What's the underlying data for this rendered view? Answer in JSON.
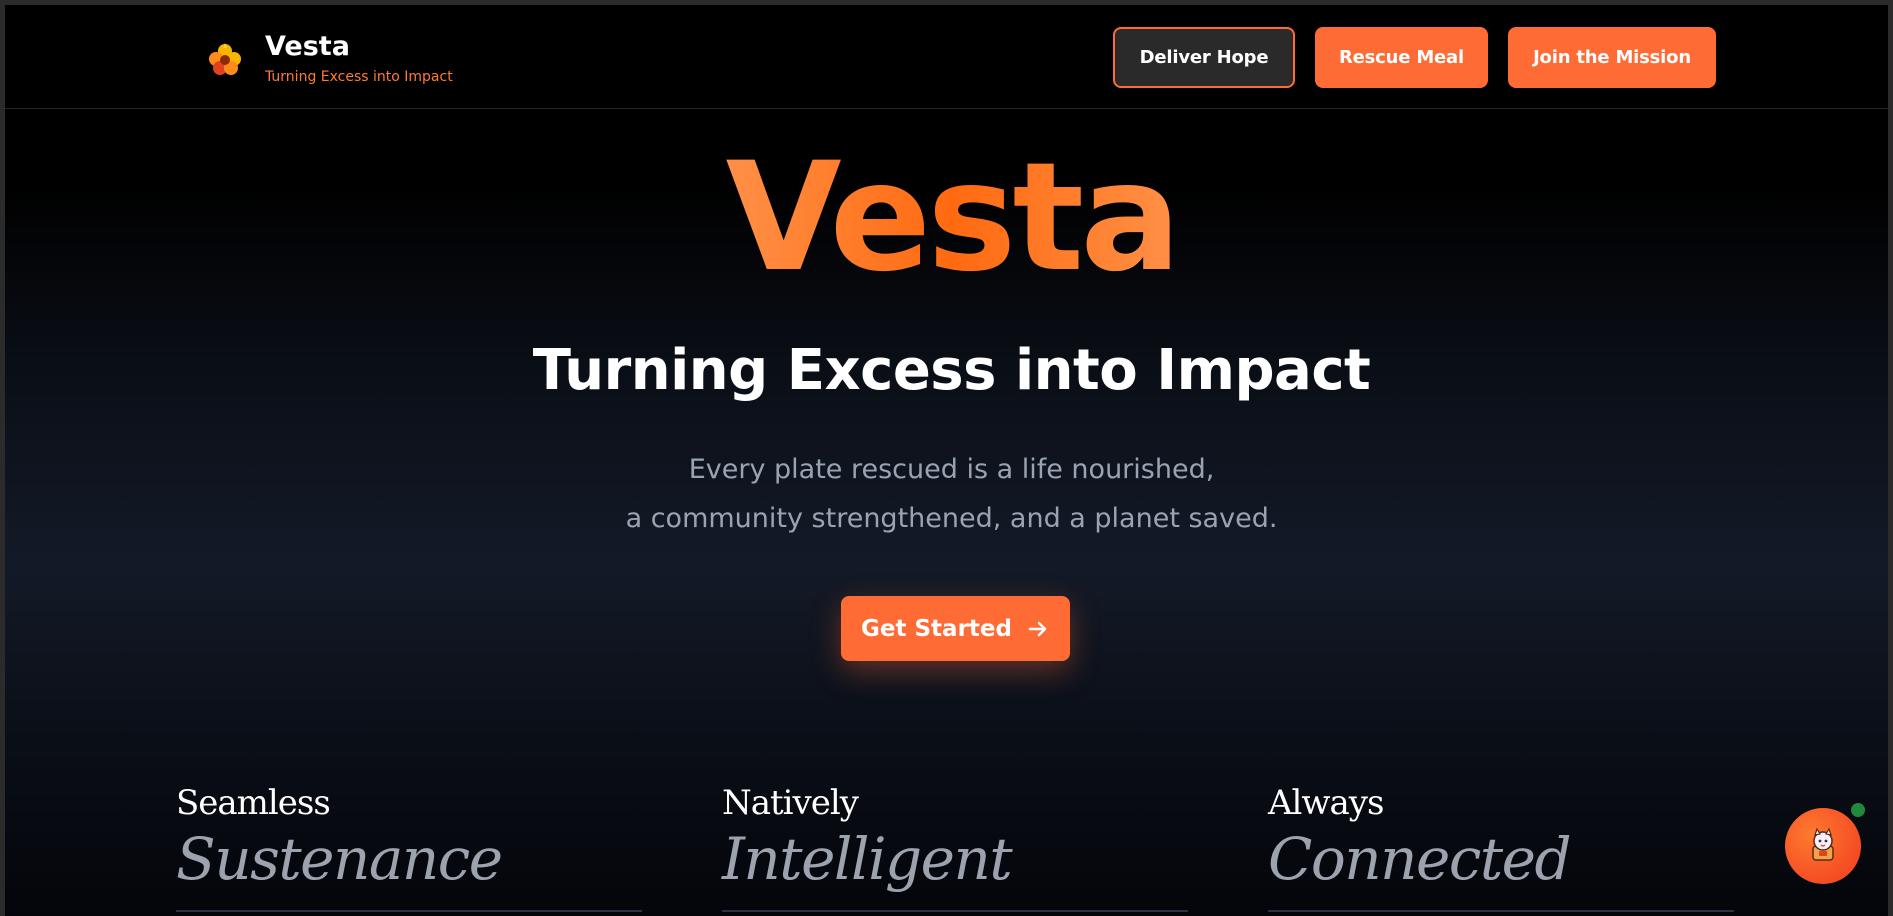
{
  "navbar": {
    "brand_name": "Vesta",
    "brand_tagline": "Turning Excess into Impact",
    "logo_icon": "flame-flower-logo",
    "buttons": {
      "deliver_hope": "Deliver Hope",
      "rescue_meal": "Rescue Meal",
      "join_mission": "Join the Mission"
    }
  },
  "hero": {
    "title": "Vesta",
    "subtitle": "Turning Excess into Impact",
    "description_line1": "Every plate rescued is a life nourished,",
    "description_line2": "a community strengthened, and a planet saved.",
    "cta_label": "Get Started",
    "cta_icon": "arrow-right-icon"
  },
  "features": [
    {
      "line1": "Seamless",
      "line2": "Sustenance"
    },
    {
      "line1": "Natively",
      "line2": "Intelligent"
    },
    {
      "line1": "Always",
      "line2": "Connected"
    }
  ],
  "chat": {
    "icon": "chatbot-mascot-icon",
    "status": "online"
  },
  "colors": {
    "accent": "#ff6b35",
    "background": "#000000",
    "muted_text": "#9aa3b2",
    "online": "#1f8a3a"
  }
}
